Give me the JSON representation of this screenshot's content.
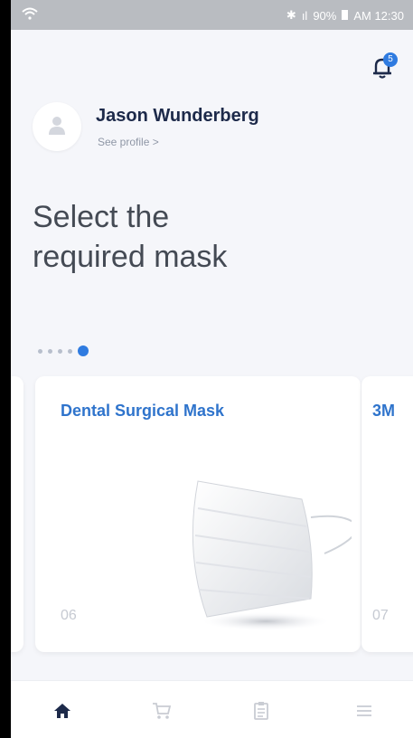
{
  "status": {
    "bluetooth": "✱",
    "signal": "ıl",
    "battery": "90%",
    "time": "AM 12:30"
  },
  "notifications": {
    "count": "5"
  },
  "profile": {
    "name": "Jason Wunderberg",
    "link": "See profile >"
  },
  "heading": {
    "line1": "Select the",
    "line2": "required mask"
  },
  "pager": {
    "total": 5,
    "active_index": 4
  },
  "cards": [
    {
      "title": "Dental Surgical Mask",
      "number": "06"
    },
    {
      "title": "3M",
      "number": "07"
    }
  ],
  "nav": {
    "items": [
      "home-icon",
      "cart-icon",
      "clipboard-icon",
      "menu-icon"
    ],
    "active": "home-icon"
  },
  "colors": {
    "accent": "#2f7be0",
    "title": "#1d2a4a",
    "card_title": "#2f74cc"
  }
}
